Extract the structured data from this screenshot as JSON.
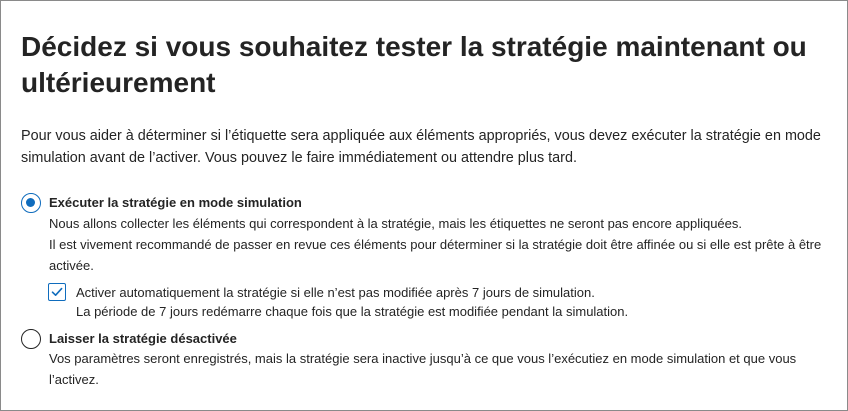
{
  "title": "Décidez si vous souhaitez tester la stratégie maintenant ou ultérieurement",
  "description": "Pour vous aider à déterminer si l’étiquette sera appliquée aux éléments appropriés, vous devez exécuter la stratégie en mode simulation avant de l’activer. Vous pouvez le faire immédiatement ou attendre plus tard.",
  "options": [
    {
      "label": "Exécuter la stratégie en mode simulation",
      "line1": "Nous allons collecter les éléments qui correspondent à la stratégie, mais les étiquettes ne seront pas encore appliquées.",
      "line2": "Il est vivement recommandé de passer en revue ces éléments pour déterminer si la stratégie doit être affinée ou si elle est prête à être activée.",
      "selected": true
    },
    {
      "label": "Laisser la stratégie désactivée",
      "text": "Vos paramètres seront enregistrés, mais la stratégie sera inactive jusqu’à ce que vous l’exécutiez en mode simulation et que vous l’activez.",
      "selected": false
    }
  ],
  "auto_activate": {
    "label": "Activer automatiquement la stratégie si elle n’est pas modifiée après 7 jours de simulation.",
    "hint": "La période de 7 jours redémarre chaque fois que la stratégie est modifiée pendant la simulation.",
    "checked": true
  },
  "colors": {
    "accent": "#0f6cbd",
    "text": "#242424",
    "border": "#8a8a8a"
  }
}
